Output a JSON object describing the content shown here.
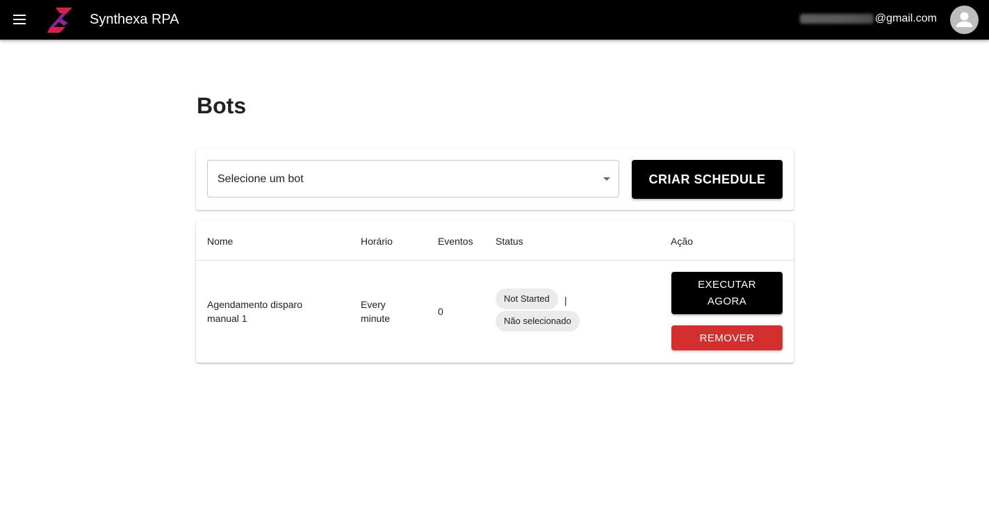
{
  "appbar": {
    "title": "Synthexa RPA",
    "menu_icon": "hamburger-menu-icon",
    "logo_icon": "synthexa-logo-icon",
    "email_domain": "@gmail.com",
    "avatar_icon": "user-avatar-icon"
  },
  "page": {
    "title": "Bots"
  },
  "bot_select": {
    "placeholder": "Selecione um bot",
    "arrow_icon": "dropdown-arrow-icon"
  },
  "actions": {
    "criar_schedule": "CRIAR SCHEDULE"
  },
  "table": {
    "columns": [
      "Nome",
      "Horário",
      "Eventos",
      "Status",
      "Ação"
    ],
    "rows": [
      {
        "nome": "Agendamento disparo manual 1",
        "horario": "Every minute",
        "eventos": "0",
        "status_chip": "Not Started",
        "separator": "|",
        "selection_chip": "Não selecionado",
        "execute_label": "EXECUTAR AGORA",
        "remove_label": "REMOVER"
      }
    ]
  },
  "colors": {
    "appbar_bg": "#000000",
    "primary_button": "#000000",
    "danger_button": "#d32f2f",
    "chip_bg": "#ebebeb",
    "logo_red": "#e31b4b",
    "logo_blue": "#2a2fd6"
  }
}
